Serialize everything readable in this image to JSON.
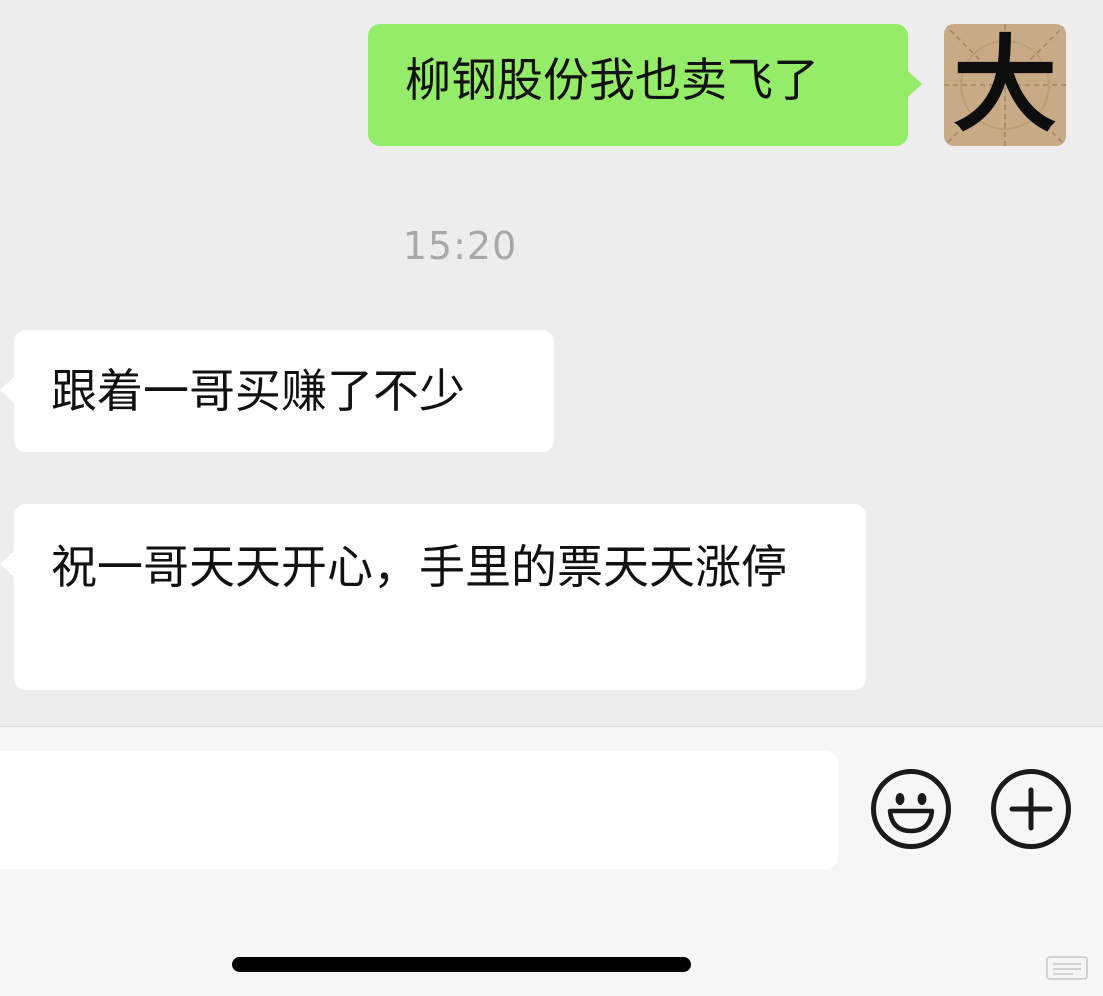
{
  "messages": [
    {
      "sender": "self",
      "text": "柳钢股份我也卖飞了"
    },
    {
      "sender": "other",
      "text": "跟着一哥买赚了不少"
    },
    {
      "sender": "other",
      "text": "祝一哥天天开心，手里的票天天涨停"
    }
  ],
  "timestamp": "15:20",
  "avatar": {
    "glyph": "大",
    "bg_color": "#c9aa86"
  },
  "colors": {
    "self_bubble": "#95ec69",
    "other_bubble": "#ffffff",
    "chat_background": "#ededed",
    "input_bar_background": "#f6f6f6"
  },
  "input_bar": {
    "text_value": "",
    "emoji_icon": "smiley-face-icon",
    "plus_icon": "plus-circle-icon"
  }
}
